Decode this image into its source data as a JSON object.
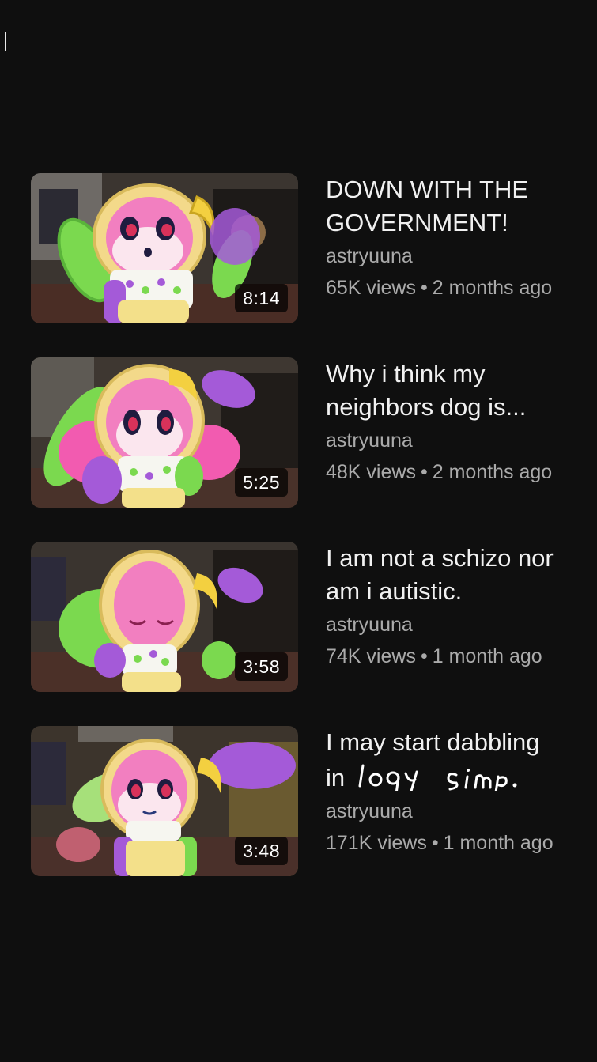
{
  "videos": [
    {
      "title_lines": [
        "DOWN WITH THE",
        "GOVERNMENT!"
      ],
      "channel": "astryuuna",
      "views": "65K views",
      "age": "2 months ago",
      "duration": "8:14",
      "separator": "•"
    },
    {
      "title_lines": [
        "Why i think my",
        "neighbors dog is..."
      ],
      "channel": "astryuuna",
      "views": "48K views",
      "age": "2 months ago",
      "duration": "5:25",
      "separator": "•"
    },
    {
      "title_lines": [
        "I am not a schizo nor",
        "am i autistic."
      ],
      "channel": "astryuuna",
      "views": "74K views",
      "age": "1 month ago",
      "duration": "3:58",
      "separator": "•"
    },
    {
      "title_lines": [
        "I may start dabbling",
        "in"
      ],
      "handwritten_overlay": "loqy simp.",
      "channel": "astryuuna",
      "views": "171K views",
      "age": "1 month ago",
      "duration": "3:48",
      "separator": "•"
    }
  ],
  "colors": {
    "background": "#0f0f0f",
    "title": "#f1f1f1",
    "secondary": "#aaaaaa",
    "pink_hair": "#f27fc0",
    "yellow_hood": "#f3d98a",
    "green_sleeve": "#7bd94f",
    "purple_sleeve": "#a45ad8"
  },
  "icons": {
    "thumbnail_character": "chibi-character-drawing",
    "handwritten": "scribble-text"
  }
}
